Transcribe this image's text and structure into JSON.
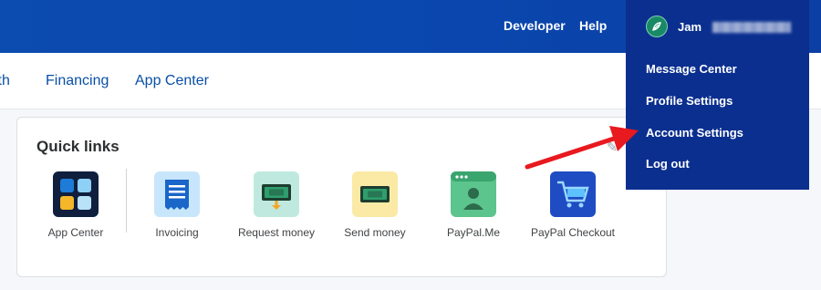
{
  "header": {
    "links": [
      "Developer",
      "Help"
    ]
  },
  "subnav": {
    "items": [
      "wth",
      "Financing",
      "App Center"
    ]
  },
  "quick_links": {
    "title": "Quick links",
    "tiles": [
      {
        "label": "App Center",
        "icon": "app-center-icon"
      },
      {
        "label": "Invoicing",
        "icon": "invoice-icon"
      },
      {
        "label": "Request money",
        "icon": "request-money-icon"
      },
      {
        "label": "Send money",
        "icon": "send-money-icon"
      },
      {
        "label": "PayPal.Me",
        "icon": "paypal-me-icon"
      },
      {
        "label": "PayPal Checkout",
        "icon": "checkout-cart-icon"
      }
    ]
  },
  "dropdown": {
    "user_name": "Jam",
    "items": [
      "Message Center",
      "Profile Settings",
      "Account Settings",
      "Log out"
    ]
  },
  "colors": {
    "header_blue": "#0b4cb0",
    "dropdown_bg": "#0b2f8f",
    "link_blue": "#0a4fa6",
    "annotation_arrow": "#e8191f"
  }
}
